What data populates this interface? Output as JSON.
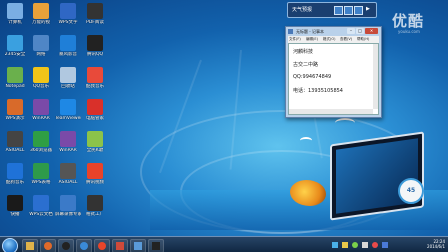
{
  "desktop_icons": [
    {
      "label": "计算机",
      "color": "#7aaee3"
    },
    {
      "label": "万能的视",
      "color": "#e8a13a"
    },
    {
      "label": "WPS文字",
      "color": "#2f67c4"
    },
    {
      "label": "PDF阅读",
      "color": "#333333"
    },
    {
      "label": "2345安全",
      "color": "#3aa0e0"
    },
    {
      "label": "网络",
      "color": "#4f86c6"
    },
    {
      "label": "暴风影音",
      "color": "#1f7fd8"
    },
    {
      "label": "腾讯QQ",
      "color": "#222222"
    },
    {
      "label": "Notepad",
      "color": "#6ab04c"
    },
    {
      "label": "QQ音乐",
      "color": "#f0c419"
    },
    {
      "label": "回收站",
      "color": "#b0c8e0"
    },
    {
      "label": "酷我音乐",
      "color": "#e84a3a"
    },
    {
      "label": "WPS演示",
      "color": "#d86a2a"
    },
    {
      "label": "WinRAR",
      "color": "#7a4aa8"
    },
    {
      "label": "TeamViewer",
      "color": "#1e88e5"
    },
    {
      "label": "电脑管家",
      "color": "#d9302a"
    },
    {
      "label": "ASIOALL",
      "color": "#444444"
    },
    {
      "label": "360浏览器",
      "color": "#2f9e44"
    },
    {
      "label": "WinRAR",
      "color": "#7a4aa8"
    },
    {
      "label": "全民K歌",
      "color": "#8bc34a"
    },
    {
      "label": "酷狗音乐",
      "color": "#1f72d8"
    },
    {
      "label": "WPS表格",
      "color": "#2e9a4a"
    },
    {
      "label": "ASIOALL",
      "color": "#555555"
    },
    {
      "label": "腾讯视频",
      "color": "#e8432a"
    },
    {
      "label": "快播",
      "color": "#1a1a1a"
    },
    {
      "label": "WPS云文档",
      "color": "#2b6fd0"
    },
    {
      "label": "屏幕录像专家",
      "color": "#3b7ac8"
    },
    {
      "label": "格式工厂",
      "color": "#333333"
    }
  ],
  "widget": {
    "text": "天气预报",
    "arrow": "▶"
  },
  "watermark": {
    "brand": "优酷",
    "sub": "youku.com"
  },
  "notepad": {
    "title": "无标题 - 记事本",
    "menu": [
      "文件(F)",
      "编辑(E)",
      "格式(O)",
      "查看(V)",
      "帮助(H)"
    ],
    "lines": [
      "河麟科技",
      "古交二中路",
      "QQ:994674849",
      "电话：13935105854"
    ]
  },
  "meter": {
    "value": "45"
  },
  "taskbar": {
    "apps": [
      {
        "name": "start-button"
      },
      {
        "name": "explorer",
        "color": "#e0b34a"
      },
      {
        "name": "media-player",
        "color": "#e06a2a"
      },
      {
        "name": "qq",
        "color": "#222222"
      },
      {
        "name": "ie",
        "color": "#3a8ad8"
      },
      {
        "name": "chrome",
        "color": "#e8452a"
      },
      {
        "name": "recorder",
        "color": "#d04a3a"
      },
      {
        "name": "notepad-task",
        "color": "#5a9ad8"
      },
      {
        "name": "terminal",
        "color": "#222222"
      }
    ],
    "clock_time": "22:24",
    "clock_date": "2014/6/1"
  }
}
